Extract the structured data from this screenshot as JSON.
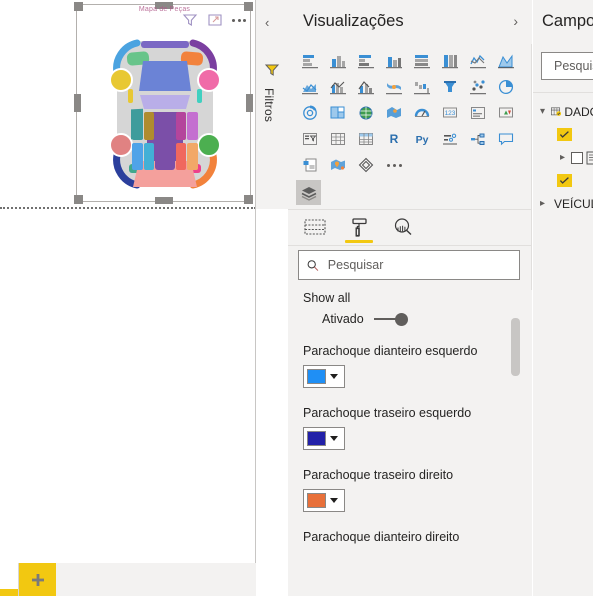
{
  "canvas": {
    "visual_title": "Mapa de Peças",
    "header_icons": [
      {
        "name": "filter-icon",
        "label": "Filtros"
      },
      {
        "name": "focus-mode-icon",
        "label": "Modo de foco"
      },
      {
        "name": "more-options-icon",
        "label": "Mais opções"
      }
    ],
    "car_map": {
      "name": "Mapa de Peças do Veículo",
      "body_color": "#d6d6d6",
      "parts": [
        {
          "name": "teto",
          "color": "#7b68c4"
        },
        {
          "name": "capo",
          "color": "#6b83d6"
        },
        {
          "name": "porta-malas",
          "color": "#f4a09c"
        },
        {
          "name": "parabrisa",
          "color": "#b9aee8"
        },
        {
          "name": "vidro-traseiro",
          "color": "#f09bc4"
        },
        {
          "name": "paralama-diant-esq",
          "color": "#68c48a"
        },
        {
          "name": "paralama-diant-dir",
          "color": "#f2823c"
        },
        {
          "name": "porta-diant-esq",
          "color": "#3f9c9c"
        },
        {
          "name": "porta-tras-esq",
          "color": "#b08c2e"
        },
        {
          "name": "porta-diant-dir",
          "color": "#b4459c"
        },
        {
          "name": "porta-tras-dir",
          "color": "#c46fd0"
        },
        {
          "name": "lateral-inf-esq-1",
          "color": "#4fa3e8"
        },
        {
          "name": "lateral-inf-esq-2",
          "color": "#43b0d6"
        },
        {
          "name": "lateral-inf-dir-1",
          "color": "#f0685e"
        },
        {
          "name": "lateral-inf-dir-2",
          "color": "#f2a868"
        },
        {
          "name": "parachoque-diant-esq",
          "color": "#4ba3e0"
        },
        {
          "name": "parachoque-diant-dir",
          "color": "#7b3fa0"
        },
        {
          "name": "parachoque-tras-esq",
          "color": "#2b3f9c"
        },
        {
          "name": "parachoque-tras-dir",
          "color": "#f2823c"
        },
        {
          "name": "farol-esq",
          "color": "#e8c832"
        },
        {
          "name": "farol-dir",
          "color": "#f06ba8"
        },
        {
          "name": "roda-tras-esq",
          "color": "#e08282"
        },
        {
          "name": "roda-tras-dir",
          "color": "#4caf50"
        },
        {
          "name": "soleira-esq",
          "color": "#3fa88c"
        },
        {
          "name": "soleira-dir",
          "color": "#ed3f8c"
        },
        {
          "name": "grade-inferior",
          "color": "#4fd0e0"
        }
      ]
    }
  },
  "filtros": {
    "label": "Filtros",
    "collapse_icon": "chevron-left-icon",
    "funnel_icon": "filter-funnel-icon"
  },
  "visualizations": {
    "title": "Visualizações",
    "collapse_icon": "chevron-right-icon",
    "gallery": [
      [
        {
          "name": "stacked-bar-chart-icon"
        },
        {
          "name": "stacked-column-chart-icon"
        },
        {
          "name": "clustered-bar-chart-icon"
        },
        {
          "name": "clustered-column-chart-icon"
        },
        {
          "name": "100-stacked-bar-chart-icon"
        },
        {
          "name": "100-stacked-column-chart-icon"
        },
        {
          "name": "line-chart-icon"
        },
        {
          "name": "area-chart-icon"
        }
      ],
      [
        {
          "name": "stacked-area-chart-icon"
        },
        {
          "name": "line-stacked-column-chart-icon"
        },
        {
          "name": "line-clustered-column-chart-icon"
        },
        {
          "name": "ribbon-chart-icon"
        },
        {
          "name": "waterfall-chart-icon"
        },
        {
          "name": "funnel-chart-icon"
        },
        {
          "name": "scatter-chart-icon"
        },
        {
          "name": "pie-chart-icon"
        }
      ],
      [
        {
          "name": "donut-chart-icon"
        },
        {
          "name": "treemap-icon"
        },
        {
          "name": "map-icon"
        },
        {
          "name": "filled-map-icon"
        },
        {
          "name": "gauge-icon"
        },
        {
          "name": "card-icon"
        },
        {
          "name": "multi-row-card-icon"
        },
        {
          "name": "kpi-icon"
        }
      ],
      [
        {
          "name": "slicer-icon"
        },
        {
          "name": "table-icon"
        },
        {
          "name": "matrix-icon"
        },
        {
          "name": "r-script-visual-icon"
        },
        {
          "name": "python-visual-icon"
        },
        {
          "name": "key-influencers-icon"
        },
        {
          "name": "decomposition-tree-icon"
        },
        {
          "name": "qna-icon"
        }
      ],
      [
        {
          "name": "paginated-report-icon"
        },
        {
          "name": "arcgis-maps-icon"
        },
        {
          "name": "power-apps-icon"
        },
        {
          "name": "more-visuals-icon"
        }
      ]
    ],
    "stack_icon": "build-visual-layers-icon",
    "format_tabs": [
      {
        "name": "tab-fields",
        "icon": "fields-table-icon",
        "selected": false
      },
      {
        "name": "tab-format",
        "icon": "paint-roller-icon",
        "selected": true
      },
      {
        "name": "tab-analytics",
        "icon": "analytics-magnifier-icon",
        "selected": false
      }
    ],
    "accent_color": "#f2c811",
    "search": {
      "icon": "search-icon",
      "placeholder": "Pesquisar",
      "value": ""
    },
    "properties": [
      {
        "type": "toggle",
        "name": "show-all",
        "label": "Show all",
        "state_text": "Ativado",
        "on": true
      },
      {
        "type": "color",
        "name": "parachoque-dianteiro-esquerdo",
        "label": "Parachoque dianteiro esquerdo",
        "color": "#1f8ff5"
      },
      {
        "type": "color",
        "name": "parachoque-traseiro-esquerdo",
        "label": "Parachoque traseiro esquerdo",
        "color": "#2321a8"
      },
      {
        "type": "color",
        "name": "parachoque-traseiro-direito",
        "label": "Parachoque traseiro direito",
        "color": "#e8703a"
      },
      {
        "type": "label-only",
        "name": "parachoque-dianteiro-direito",
        "label": "Parachoque dianteiro direito"
      }
    ]
  },
  "campos": {
    "title": "Campos",
    "search": {
      "icon": "search-icon",
      "placeholder": "Pesquisar"
    },
    "tree": [
      {
        "name": "table-dados",
        "label": "DADOS",
        "level": 1,
        "expanded": true,
        "icon": "table-checked-icon"
      },
      {
        "name": "field-checked-1",
        "label": "",
        "level": 2,
        "icon": "checked-field-icon"
      },
      {
        "name": "folder-group",
        "label": "",
        "level": 2,
        "expanded": false,
        "icon": "folder-icon",
        "checkbox": true
      },
      {
        "name": "field-checked-2",
        "label": "",
        "level": 3,
        "icon": "checked-field-icon"
      },
      {
        "name": "table-veiculos",
        "label": "VEÍCULOS",
        "level": 1,
        "expanded": false,
        "icon": "table-icon"
      }
    ]
  },
  "page_tabs": {
    "add_button": {
      "name": "add-page-button",
      "icon": "plus-icon",
      "color": "#f2c811"
    }
  }
}
